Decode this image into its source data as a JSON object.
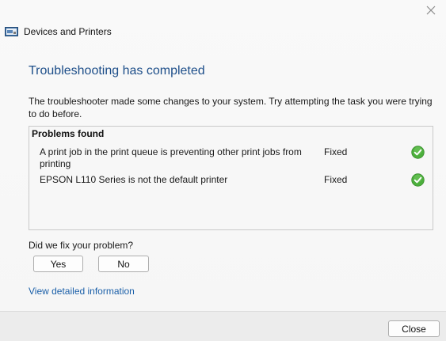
{
  "window": {
    "title": "Devices and Printers",
    "close_icon": "close-icon"
  },
  "main": {
    "heading": "Troubleshooting has completed",
    "description": "The troubleshooter made some changes to your system. Try attempting the task you were trying to do before."
  },
  "problems": {
    "header": "Problems found",
    "items": [
      {
        "description": "A print job in the print queue is preventing other print jobs from printing",
        "status": "Fixed",
        "icon": "check-circle-icon"
      },
      {
        "description": "EPSON L110 Series is not the default printer",
        "status": "Fixed",
        "icon": "check-circle-icon"
      }
    ]
  },
  "feedback": {
    "question": "Did we fix your problem?",
    "yes_label": "Yes",
    "no_label": "No"
  },
  "link": {
    "detailed_info": "View detailed information"
  },
  "footer": {
    "close_label": "Close"
  },
  "colors": {
    "heading": "#1d4e89",
    "link": "#1a5fa8",
    "check_green": "#4caf3c"
  }
}
